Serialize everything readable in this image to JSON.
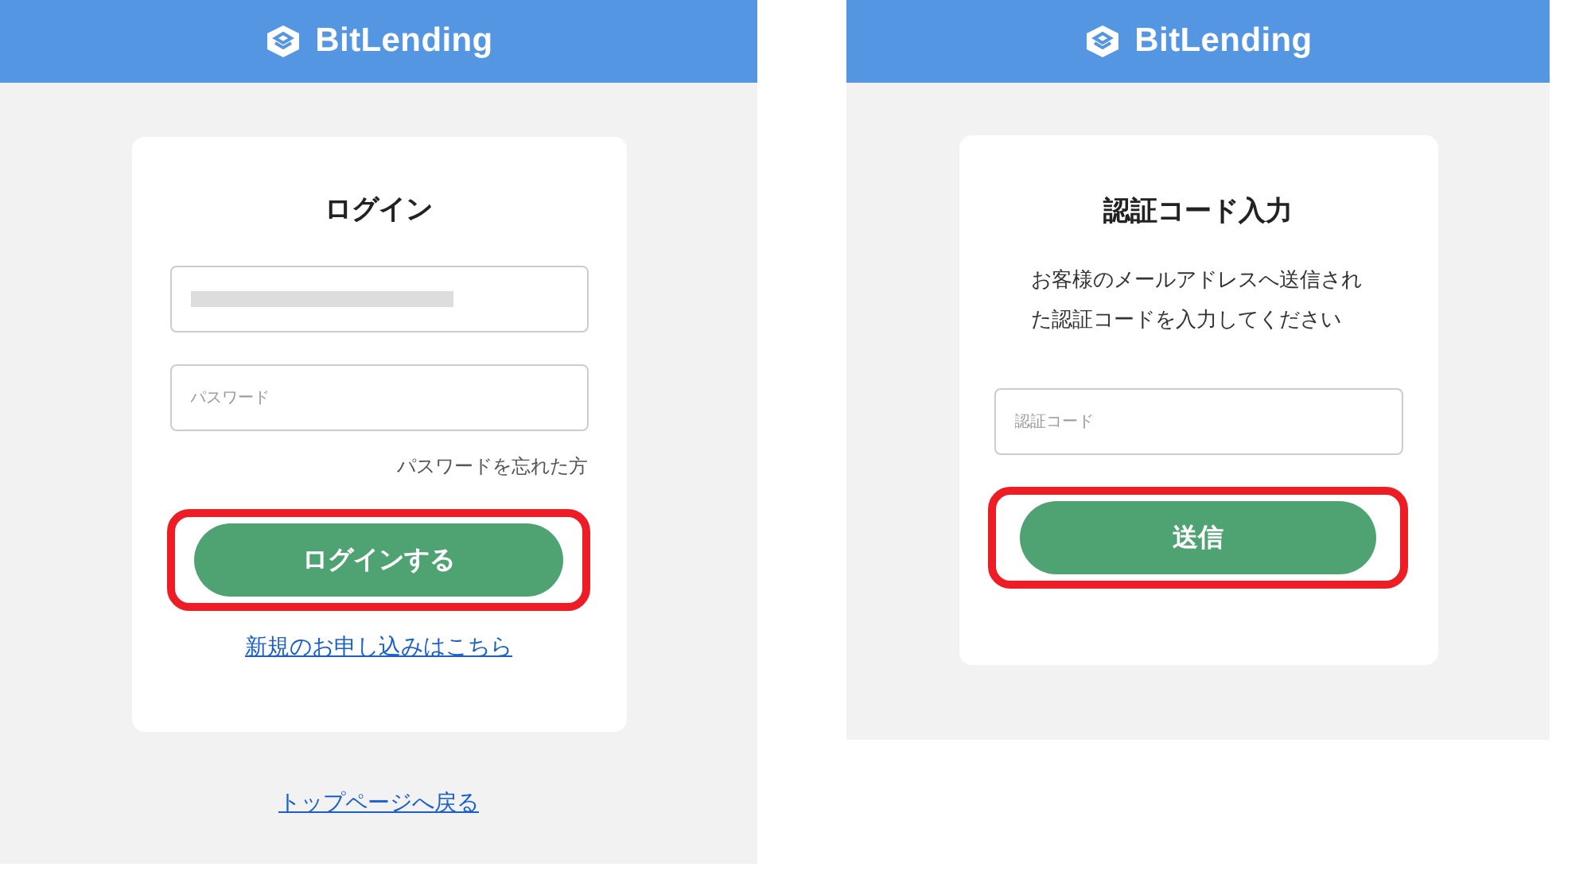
{
  "screens": [
    {
      "kind": "login",
      "brand": "BitLending",
      "title": "ログイン",
      "fields": [
        {
          "kind": "redacted"
        },
        {
          "kind": "text",
          "placeholder": "パスワード"
        }
      ],
      "forgot_link": "パスワードを忘れた方",
      "button": {
        "label": "ログインする",
        "highlighted": true
      },
      "signup_link": "新規のお申し込みはこちら",
      "back_link": "トップページへ戻る"
    },
    {
      "kind": "verify",
      "brand": "BitLending",
      "title": "認証コード入力",
      "message": "お客様のメールアドレスへ送信された認証コードを入力してください",
      "fields": [
        {
          "kind": "text",
          "placeholder": "認証コード"
        }
      ],
      "button": {
        "label": "送信",
        "highlighted": true
      }
    }
  ]
}
